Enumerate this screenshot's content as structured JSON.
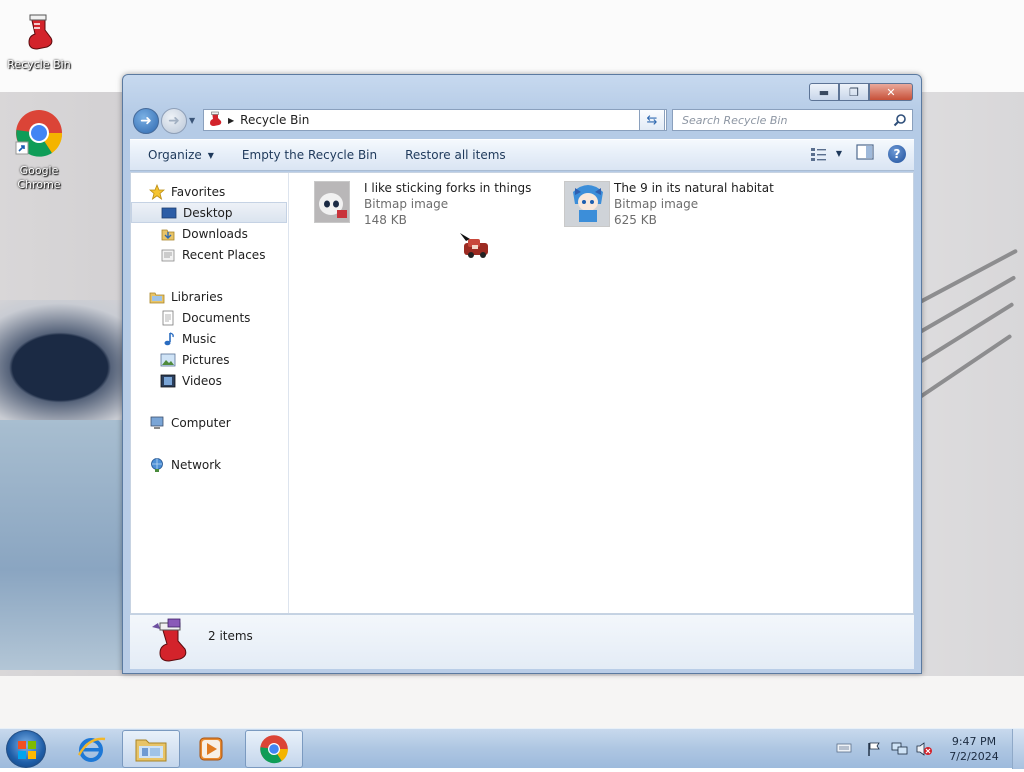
{
  "desktop": {
    "icons": [
      {
        "label": "Recycle Bin"
      },
      {
        "label": "Google Chrome"
      }
    ]
  },
  "window": {
    "address": {
      "location": "Recycle Bin"
    },
    "search": {
      "placeholder": "Search Recycle Bin"
    },
    "toolbar": {
      "organize_label": "Organize",
      "empty_label": "Empty the Recycle Bin",
      "restore_label": "Restore all items"
    },
    "nav_pane": {
      "favorites": "Favorites",
      "desktop": "Desktop",
      "downloads": "Downloads",
      "recent_places": "Recent Places",
      "libraries": "Libraries",
      "documents": "Documents",
      "music": "Music",
      "pictures": "Pictures",
      "videos": "Videos",
      "computer": "Computer",
      "network": "Network"
    },
    "files": [
      {
        "name": "I like sticking forks in things",
        "type": "Bitmap image",
        "size": "148 KB"
      },
      {
        "name": "The 9 in its natural habitat",
        "type": "Bitmap image",
        "size": "625 KB"
      }
    ],
    "details": {
      "count": "2 items"
    }
  },
  "taskbar": {
    "clock": {
      "time": "9:47 PM",
      "date": "7/2/2024"
    }
  },
  "colors": {
    "accent": "#2f69b0",
    "window_frame": "#b9cde7",
    "command_bar_text": "#1e395b",
    "close_button": "#c75038"
  },
  "icons": [
    "recycle-bin-icon",
    "chrome-icon",
    "back-arrow-icon",
    "forward-arrow-icon",
    "search-icon",
    "refresh-icon",
    "views-icon",
    "preview-pane-icon",
    "help-icon",
    "star-icon",
    "desktop-icon",
    "downloads-icon",
    "recent-places-icon",
    "libraries-icon",
    "documents-icon",
    "music-icon",
    "pictures-icon",
    "videos-icon",
    "computer-icon",
    "network-icon",
    "windows-start-icon",
    "internet-explorer-icon",
    "explorer-folder-icon",
    "media-player-icon",
    "keyboard-icon",
    "action-center-flag-icon",
    "network-tray-icon",
    "volume-muted-icon"
  ]
}
